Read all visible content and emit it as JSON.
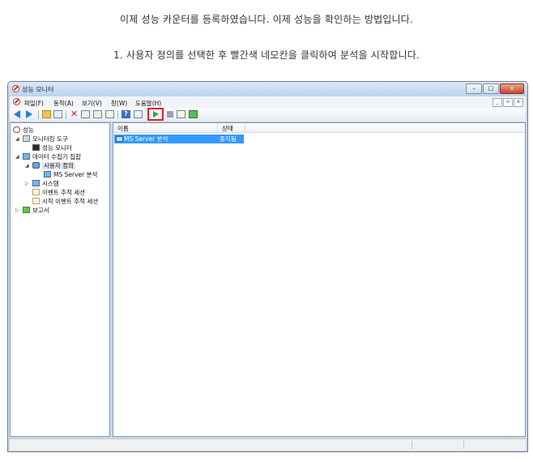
{
  "captions": {
    "line1": "이제 성능 카운터를 등록하였습니다. 이제 성능을 확인하는 방법입니다.",
    "line2": "1. 사용자 정의를 선택한 후 빨간색 네모칸을 클릭하여 분석을 시작합니다."
  },
  "window": {
    "title": "성능 모니터",
    "controls": {
      "minimize": "–",
      "maximize": "□",
      "close": "x"
    }
  },
  "menu": {
    "items": [
      "파일(F)",
      "동작(A)",
      "보기(V)",
      "창(W)",
      "도움말(H)"
    ],
    "mdi": {
      "minimize": "_",
      "restore": "▫",
      "close": "x"
    }
  },
  "toolbar": {
    "icons": [
      "back-icon",
      "forward-icon",
      "folder-up-icon",
      "show-hide-tree-icon",
      "delete-icon",
      "properties-icon",
      "refresh-icon",
      "export-icon",
      "help-icon",
      "view-icon",
      "start-icon",
      "stop-icon",
      "new-icon",
      "report-icon"
    ],
    "highlight_color": "#e0202a"
  },
  "tree": {
    "root": "성능",
    "monitoring_tools": "모니터링 도구",
    "performance_monitor": "성능 모니터",
    "data_collector_sets": "데이터 수집기 집합",
    "user_defined": "사용자 정의",
    "ms_server_analysis": "MS Server 분석",
    "system": "시스템",
    "event_trace_sessions": "이벤트 추적 세션",
    "startup_event_trace_sessions": "시작 이벤트 추적 세션",
    "reports": "보고서"
  },
  "list": {
    "columns": {
      "name": "이름",
      "status": "상태"
    },
    "rows": [
      {
        "name": "MS Server 분석",
        "status": "중지됨"
      }
    ],
    "selection_color": "#3399ff"
  }
}
